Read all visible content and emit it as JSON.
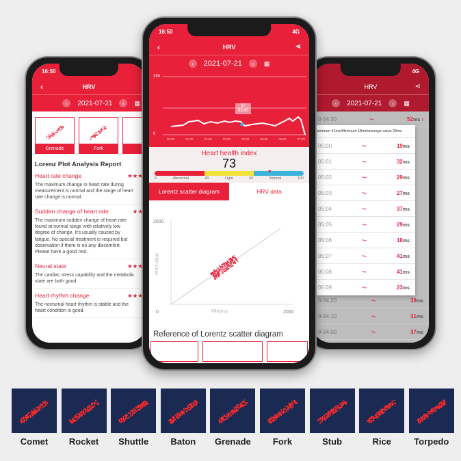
{
  "left_phone": {
    "time": "16:50",
    "title": "HRV",
    "date": "2021-07-21",
    "thumbs": [
      "Grenade",
      "Fork"
    ],
    "report_title": "Lorenz Plot Analysis Report",
    "items": [
      {
        "title": "Heart rate change",
        "stars": "★★★",
        "desc": [
          "The maximum change in heart rate during",
          "measurement is normal and the range of heart",
          "rate change is normal."
        ]
      },
      {
        "title": "Sudden change of heart rate",
        "stars": "★★",
        "desc": [
          "The maximum sudden change of heart rate",
          "found at normal range with relatively low",
          "degree of change. It's usually caused by",
          "fatigue. No special treatment is required but",
          "observation if there is no any discomfort.",
          "Please have a good rest."
        ]
      },
      {
        "title": "Neural state",
        "stars": "★★★",
        "desc": [
          "The cardiac stress capability and the metabolic",
          "state are both good."
        ]
      },
      {
        "title": "Heart rhythm change",
        "stars": "★★★",
        "desc": [
          "The nocturnal heart rhythm is stable and the",
          "heart condition is good."
        ]
      }
    ]
  },
  "center_phone": {
    "time": "16:50",
    "network": "4G",
    "title": "HRV",
    "date": "2021-07-21",
    "chart": {
      "y_max": "250",
      "y_min": "0",
      "tooltip_value": "37",
      "tooltip_time": "03:40",
      "x_ticks": [
        "00:00",
        "01:00",
        "02:00",
        "03:00",
        "04:00",
        "05:00",
        "06:00",
        "07:00"
      ]
    },
    "health_label": "Heart health index",
    "health_value": "73",
    "health_fraction": 0.77,
    "scale_labels": [
      "0",
      "Abnormal",
      "40",
      "Light",
      "60",
      "Normal",
      "100"
    ],
    "tabs": [
      "Lorentz scatter diagram",
      "HRV data"
    ],
    "scatter": {
      "y_max": "2000",
      "x_min": "0",
      "x_max": "2000",
      "x_label": "RRN(ms)",
      "y_label": "RRN+1(ms)"
    },
    "reference_title": "Reference of Lorentz scatter diagram"
  },
  "right_phone": {
    "title": "HRV",
    "date": "2021-07-21",
    "network": "4G",
    "popup_summary": "Maximum 41ms/Minimum 18ms/average value 29ms",
    "popup_rows": [
      [
        "05:00",
        "19"
      ],
      [
        "05:01",
        "32"
      ],
      [
        "05:02",
        "29"
      ],
      [
        "05:03",
        "27"
      ],
      [
        "05:04",
        "37"
      ],
      [
        "05:05",
        "29"
      ],
      [
        "05:06",
        "18"
      ],
      [
        "05:07",
        "41"
      ],
      [
        "05:08",
        "41"
      ],
      [
        "05:09",
        "23"
      ]
    ],
    "bg_rows": [
      [
        "0-04:30",
        "52"
      ],
      [
        "0-04:20",
        "39"
      ],
      [
        "0-04:10",
        "31"
      ],
      [
        "0-04:00",
        "37"
      ]
    ],
    "unit": "ms"
  },
  "reference_types": [
    "Comet",
    "Rocket",
    "Shuttle",
    "Baton",
    "Grenade",
    "Fork",
    "Stub",
    "Rice",
    "Torpedo"
  ],
  "colors": {
    "accent": "#e8203a",
    "reference_bg": "#1b2a52",
    "abnormal": "#e8203a",
    "light": "#f2e33a",
    "normal": "#3cb4dc"
  }
}
